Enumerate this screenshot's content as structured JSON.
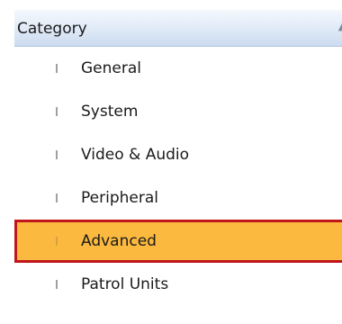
{
  "header": {
    "title": "Category",
    "collapse_icon": "collapse-arrow-icon"
  },
  "items": [
    {
      "label": "General",
      "selected": false
    },
    {
      "label": "System",
      "selected": false
    },
    {
      "label": "Video & Audio",
      "selected": false
    },
    {
      "label": "Peripheral",
      "selected": false
    },
    {
      "label": "Advanced",
      "selected": true
    },
    {
      "label": "Patrol Units",
      "selected": false
    }
  ],
  "colors": {
    "selected_background": "#fbb93f",
    "selected_border": "#c0161b",
    "header_gradient_bottom": "#cbdbf0"
  }
}
